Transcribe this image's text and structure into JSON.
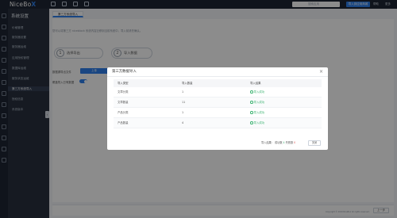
{
  "app": {
    "logo_text": "NiceBo",
    "logo_accent": "X",
    "brand_color": "#2f80ed"
  },
  "topbar": {
    "search_placeholder": "搜索应用",
    "primary_button": "导入到应用商城",
    "nav": [
      "帮助",
      "更多"
    ]
  },
  "sidebar": {
    "title": "系统设置",
    "items": [
      {
        "label": "价格管理"
      },
      {
        "label": "服务器设置"
      },
      {
        "label": "服务器运维"
      },
      {
        "label": "应用授权管理"
      },
      {
        "label": "数据库运维"
      },
      {
        "label": "服务状态运维"
      },
      {
        "label": "第三方系统导入",
        "active": true
      },
      {
        "label": "授权信息"
      },
      {
        "label": "系统版本"
      }
    ]
  },
  "main": {
    "tab": "第三方系统导入",
    "description": "您可以将第三方 niceblock 系统内容迁移到当前系统中，导入前请先确认。",
    "steps": [
      {
        "num": "1",
        "label": "选择导出"
      },
      {
        "num": "2",
        "label": "导入数据"
      }
    ],
    "form": {
      "label1": "数据源导出文件",
      "upload_button": "上传",
      "label2": "覆盖导入已有数据"
    },
    "next_button": "上一步",
    "copyright": "Copyright © 2019 NiceBox All rights reserved."
  },
  "modal": {
    "title": "第三方数据导入",
    "columns": [
      "导入类型",
      "导入数量",
      "导入结果"
    ],
    "rows": [
      {
        "type": "文章分类",
        "count": "1",
        "result": "导入成功"
      },
      {
        "type": "文章数量",
        "count": "11",
        "result": "导入成功"
      },
      {
        "type": "产品分类",
        "count": "1",
        "result": "导入成功"
      },
      {
        "type": "产品数量",
        "count": "4",
        "result": "导入成功"
      }
    ],
    "summary": {
      "prefix": "导入结果：",
      "success_label": "成功数",
      "success_value": "4",
      "fail_label": "失败数",
      "fail_value": "0"
    },
    "close_button": "关闭"
  }
}
